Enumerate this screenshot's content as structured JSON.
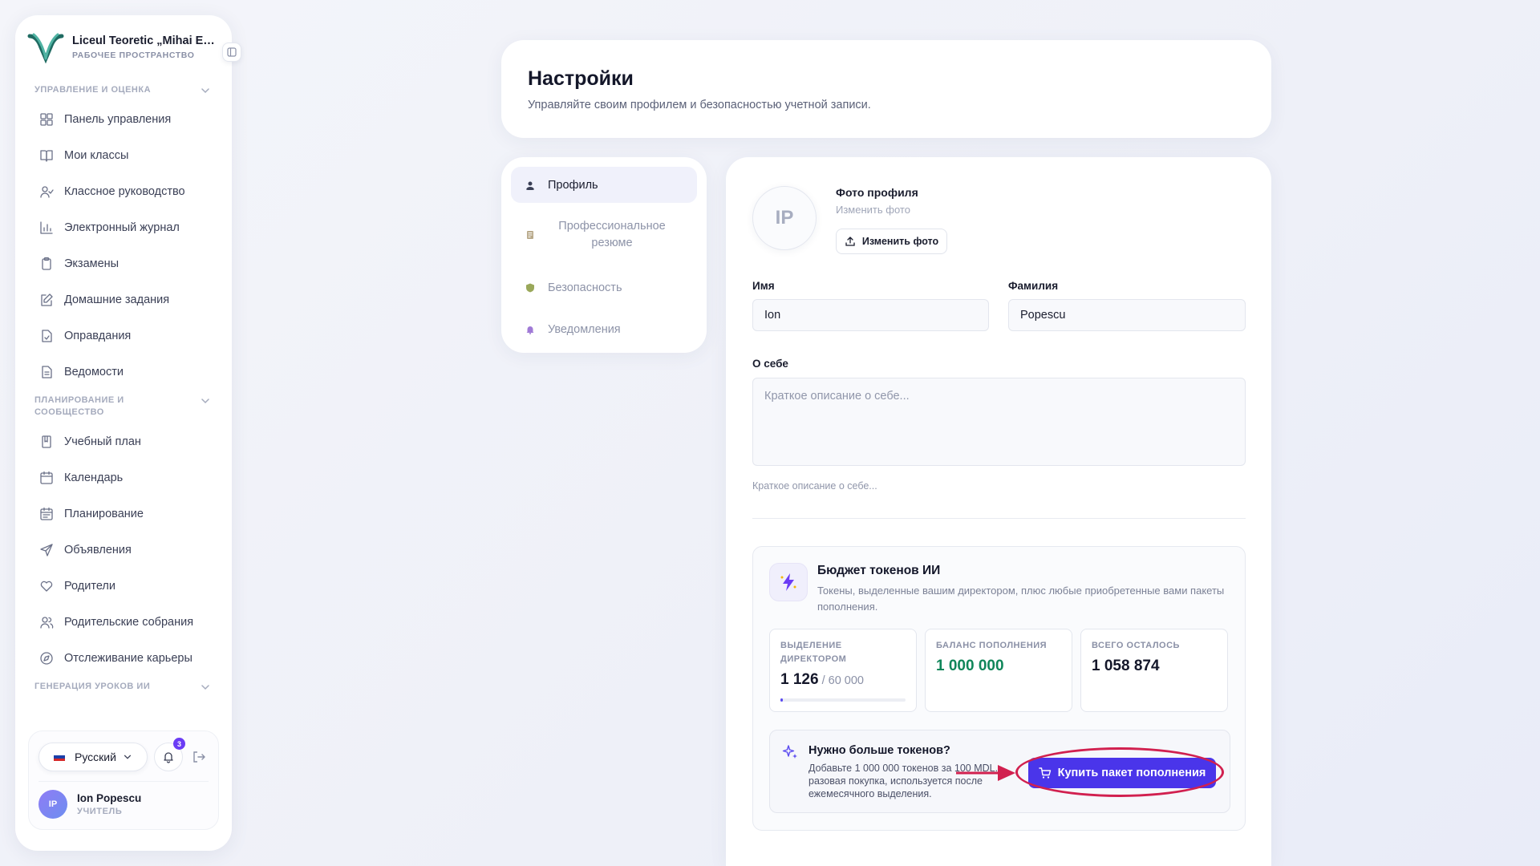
{
  "sidebar": {
    "workspace_name": "Liceul Teoretic „Mihai Eminescu”",
    "workspace_sub": "РАБОЧЕЕ ПРОСТРАНСТВО",
    "section1_title": "УПРАВЛЕНИЕ И ОЦЕНКА",
    "section1_items": [
      {
        "label": "Панель управления",
        "icon": "dashboard-icon"
      },
      {
        "label": "Мои классы",
        "icon": "book-icon"
      },
      {
        "label": "Классное руководство",
        "icon": "user-check-icon"
      },
      {
        "label": "Электронный журнал",
        "icon": "bar-chart-icon"
      },
      {
        "label": "Экзамены",
        "icon": "clipboard-icon"
      },
      {
        "label": "Домашние задания",
        "icon": "edit-icon"
      },
      {
        "label": "Оправдания",
        "icon": "file-check-icon"
      },
      {
        "label": "Ведомости",
        "icon": "file-text-icon"
      }
    ],
    "section2_title": "ПЛАНИРОВАНИЕ И СООБЩЕСТВО",
    "section2_items": [
      {
        "label": "Учебный план",
        "icon": "notebook-icon"
      },
      {
        "label": "Календарь",
        "icon": "calendar-icon"
      },
      {
        "label": "Планирование",
        "icon": "calendar-plan-icon"
      },
      {
        "label": "Объявления",
        "icon": "send-icon"
      },
      {
        "label": "Родители",
        "icon": "heart-icon"
      },
      {
        "label": "Родительские собрания",
        "icon": "users-icon"
      },
      {
        "label": "Отслеживание карьеры",
        "icon": "compass-icon"
      }
    ],
    "section3_title": "ГЕНЕРАЦИЯ УРОКОВ ИИ",
    "language": "Русский",
    "notifications_count": "3",
    "user_initials": "IP",
    "user_name": "Ion Popescu",
    "user_role": "УЧИТЕЛЬ"
  },
  "header": {
    "title": "Настройки",
    "subtitle": "Управляйте своим профилем и безопасностью учетной записи."
  },
  "tabs": [
    {
      "label": "Профиль",
      "icon": "profile-icon",
      "active": true
    },
    {
      "label": "Профессиональное резюме",
      "icon": "resume-icon",
      "active": false
    },
    {
      "label": "Безопасность",
      "icon": "shield-icon",
      "active": false
    },
    {
      "label": "Уведомления",
      "icon": "bell-icon",
      "active": false
    }
  ],
  "profile": {
    "avatar_initials": "IP",
    "photo_title": "Фото профиля",
    "photo_subtitle": "Изменить фото",
    "photo_button": "Изменить фото",
    "first_name_label": "Имя",
    "first_name_value": "Ion",
    "last_name_label": "Фамилия",
    "last_name_value": "Popescu",
    "about_label": "О себе",
    "about_placeholder": "Краткое описание о себе...",
    "about_hint": "Краткое описание о себе..."
  },
  "tokens": {
    "title": "Бюджет токенов ИИ",
    "description": "Токены, выделенные вашим директором, плюс любые приобретенные вами пакеты пополнения.",
    "stats": [
      {
        "label": "ВЫДЕЛЕНИЕ ДИРЕКТОРОМ",
        "value": "1 126",
        "total": " / 60 000",
        "progress": 0.019
      },
      {
        "label": "БАЛАНС ПОПОЛНЕНИЯ",
        "value": "1 000 000"
      },
      {
        "label": "ВСЕГО ОСТАЛОСЬ",
        "value": "1 058 874"
      }
    ],
    "promo_title": "Нужно больше токенов?",
    "promo_desc": "Добавьте 1 000 000 токенов за 100 MDL. разовая покупка, используется после ежемесячного выделения.",
    "buy_button": "Купить пакет пополнения"
  },
  "colors": {
    "accent": "#4a35ea",
    "highlight": "#d1204f",
    "green": "#10865a"
  }
}
